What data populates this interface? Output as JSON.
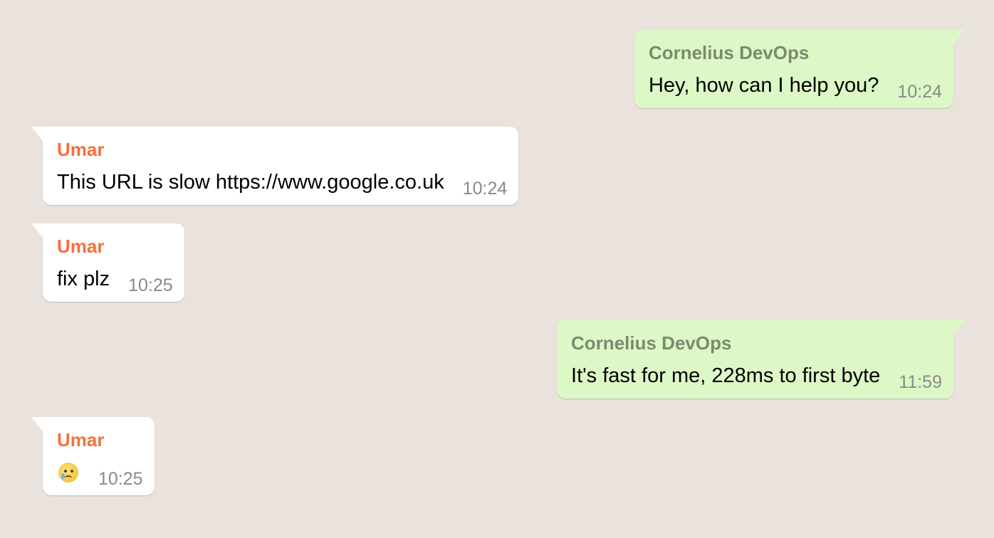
{
  "conversation": {
    "messages": [
      {
        "direction": "out",
        "sender": "Cornelius DevOps",
        "text": "Hey, how can I help you?",
        "time": "10:24"
      },
      {
        "direction": "in",
        "sender": "Umar",
        "text": "This URL is slow https://www.google.co.uk",
        "time": "10:24"
      },
      {
        "direction": "in",
        "sender": "Umar",
        "text": "fix plz",
        "time": "10:25"
      },
      {
        "direction": "out",
        "sender": "Cornelius DevOps",
        "text": "It's fast for me, 228ms to first byte",
        "time": "11:59"
      },
      {
        "direction": "in",
        "sender": "Umar",
        "emoji": "crying-face-icon",
        "time": "10:25"
      }
    ]
  },
  "colors": {
    "background": "#eae3dd",
    "incoming_bubble": "#ffffff",
    "outgoing_bubble": "#dcf8c6",
    "incoming_sender": "#f5703c",
    "outgoing_sender": "#7c8a6e",
    "timestamp": "#8a8a8a"
  }
}
